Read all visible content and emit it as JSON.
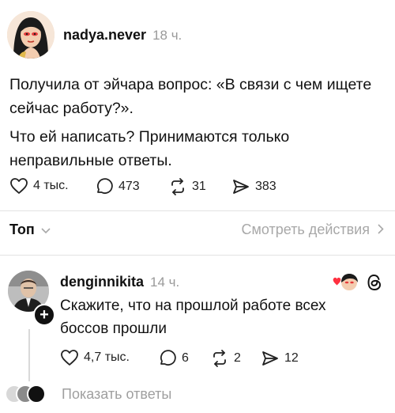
{
  "post": {
    "username": "nadya.never",
    "time": "18 ч.",
    "text_paragraph_1": "Получила от эйчара вопрос: «В связи с чем ищете\nсейчас работу?».",
    "text_paragraph_2": "Что ей написать? Принимаются только\nнеправильные ответы.",
    "stats": {
      "likes": "4 тыс.",
      "comments": "473",
      "reposts": "31",
      "shares": "383"
    }
  },
  "sort_bar": {
    "sort_label": "Топ",
    "view_activity_label": "Смотреть действия"
  },
  "reply": {
    "username": "denginnikita",
    "time": "14 ч.",
    "text": "Скажите, что на прошлой работе всех\nбоссов прошли",
    "stats": {
      "likes": "4,7 тыс.",
      "comments": "6",
      "reposts": "2",
      "shares": "12"
    },
    "show_replies_label": "Показать ответы",
    "follow_badge": "+"
  },
  "icons": {
    "like": "heart-icon",
    "comment": "comment-bubble-icon",
    "repost": "repost-icon",
    "share": "send-icon",
    "sort_chevron": "chevron-down-icon",
    "activity_chevron": "chevron-right-icon",
    "threads": "threads-logo-icon",
    "liked_by_author": "liked-by-author-icon"
  },
  "colors": {
    "text": "#111111",
    "muted": "#9a9a9a",
    "divider": "#e3e3e3",
    "like_red": "#ff3040"
  }
}
